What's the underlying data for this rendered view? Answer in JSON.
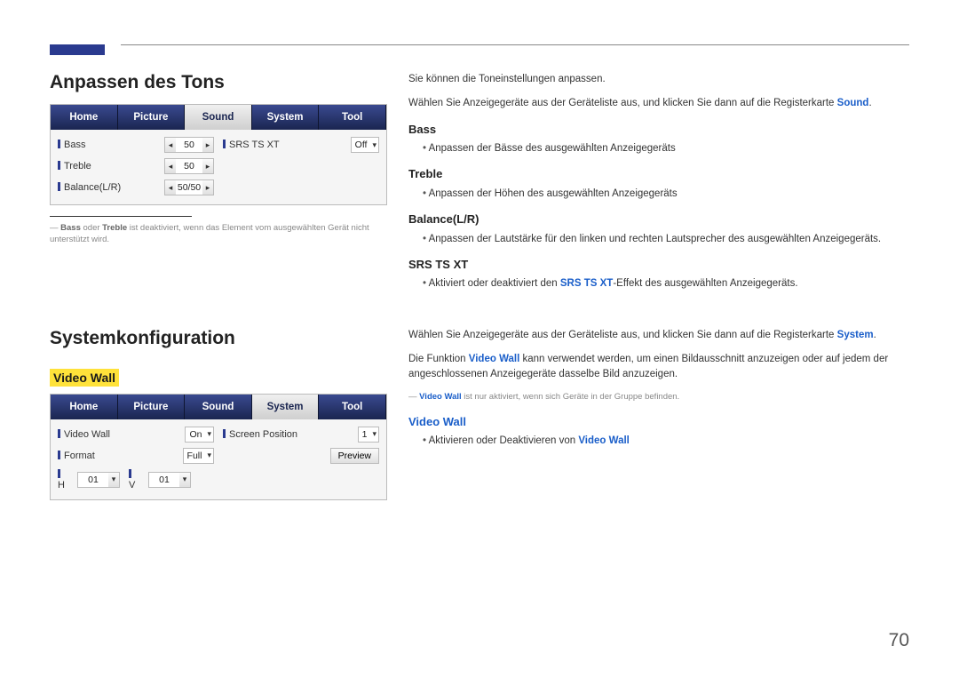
{
  "page_number": "70",
  "accent_color": "#2a3a8f",
  "section1": {
    "title": "Anpassen des Tons",
    "tabs": {
      "home": "Home",
      "picture": "Picture",
      "sound": "Sound",
      "system": "System",
      "tool": "Tool"
    },
    "rows": {
      "bass_label": "Bass",
      "bass_value": "50",
      "treble_label": "Treble",
      "treble_value": "50",
      "balance_label": "Balance(L/R)",
      "balance_value": "50/50",
      "srs_label": "SRS TS XT",
      "srs_value": "Off"
    },
    "footnote_pre": "Bass",
    "footnote_mid": " oder ",
    "footnote_bold2": "Treble",
    "footnote_post": " ist deaktiviert, wenn das Element vom ausgewählten Gerät nicht unterstützt wird.",
    "right": {
      "intro1": "Sie können die Toneinstellungen anpassen.",
      "intro2_pre": "Wählen Sie Anzeigegeräte aus der Geräteliste aus, und klicken Sie dann auf die Registerkarte ",
      "intro2_kw": "Sound",
      "intro2_post": ".",
      "bass_h": "Bass",
      "bass_li": "Anpassen der Bässe des ausgewählten Anzeigegeräts",
      "treble_h": "Treble",
      "treble_li": "Anpassen der Höhen des ausgewählten Anzeigegeräts",
      "bal_h": "Balance(L/R)",
      "bal_li": "Anpassen der Lautstärke für den linken und rechten Lautsprecher des ausgewählten Anzeigegeräts.",
      "srs_h": "SRS TS XT",
      "srs_li_pre": "Aktiviert oder deaktiviert den ",
      "srs_li_kw": "SRS TS XT",
      "srs_li_post": "-Effekt des ausgewählten Anzeigegeräts."
    }
  },
  "section2": {
    "title": "Systemkonfiguration",
    "subheading": "Video Wall",
    "tabs": {
      "home": "Home",
      "picture": "Picture",
      "sound": "Sound",
      "system": "System",
      "tool": "Tool"
    },
    "rows": {
      "vw_label": "Video Wall",
      "vw_value": "On",
      "format_label": "Format",
      "format_value": "Full",
      "h_label": "H",
      "h_value": "01",
      "v_label": "V",
      "v_value": "01",
      "sp_label": "Screen Position",
      "sp_value": "1",
      "preview_btn": "Preview"
    },
    "right": {
      "intro1_pre": "Wählen Sie Anzeigegeräte aus der Geräteliste aus, und klicken Sie dann auf die Registerkarte ",
      "intro1_kw": "System",
      "intro1_post": ".",
      "intro2_pre": "Die Funktion ",
      "intro2_kw": "Video Wall",
      "intro2_post": " kann verwendet werden, um einen Bildausschnitt anzuzeigen oder auf jedem der angeschlossenen Anzeigegeräte dasselbe Bild anzuzeigen.",
      "note_kw": "Video Wall",
      "note_post": " ist nur aktiviert, wenn sich Geräte in der Gruppe befinden.",
      "vw_h": "Video Wall",
      "vw_li_pre": "Aktivieren oder Deaktivieren von ",
      "vw_li_kw": "Video Wall"
    }
  }
}
